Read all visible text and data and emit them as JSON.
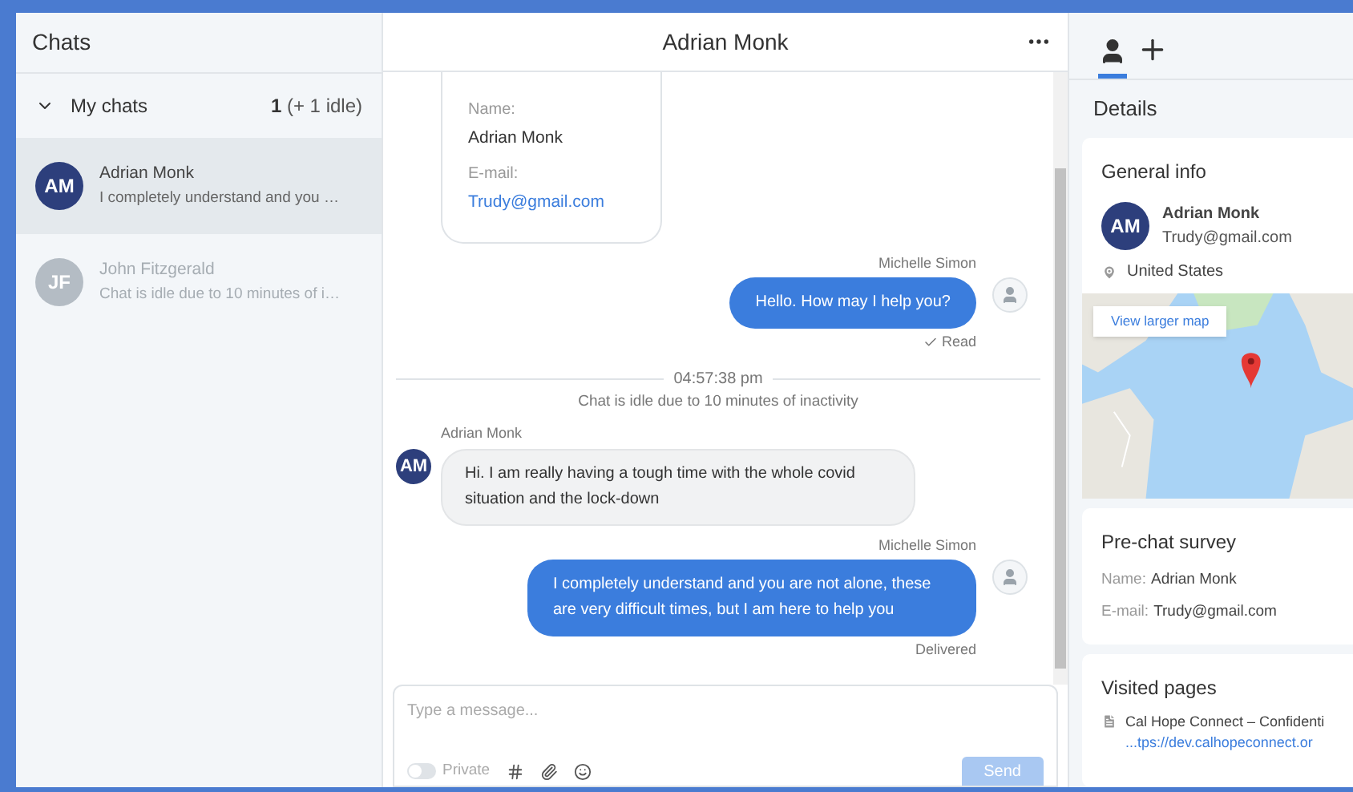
{
  "sidebar": {
    "title": "Chats",
    "group": {
      "label": "My chats",
      "expanded": true,
      "count": "1",
      "idle": "(+ 1 idle)"
    },
    "chats": [
      {
        "initials": "AM",
        "name": "Adrian Monk",
        "preview": "I completely understand and you …",
        "selected": true,
        "idle": false
      },
      {
        "initials": "JF",
        "name": "John Fitzgerald",
        "preview": "Chat is idle due to 10 minutes of i…",
        "selected": false,
        "idle": true
      }
    ]
  },
  "conversation": {
    "title": "Adrian Monk",
    "form_card": [
      {
        "label": "Name:",
        "value": "Adrian Monk",
        "kind": "text"
      },
      {
        "label": "E-mail:",
        "value": "Trudy@gmail.com",
        "kind": "link"
      }
    ],
    "messages": [
      {
        "kind": "agent",
        "author": "Michelle Simon",
        "text": "Hello. How may I help you?",
        "status": "Read",
        "read": true
      },
      {
        "kind": "system",
        "time": "04:57:38 pm",
        "text": "Chat is idle due to 10 minutes of inactivity"
      },
      {
        "kind": "visitor",
        "author": "Adrian Monk",
        "initials": "AM",
        "text": "Hi. I am really having a tough time with the whole covid situation and the lock-down"
      },
      {
        "kind": "agent",
        "author": "Michelle Simon",
        "text": "I completely understand and you are not alone, these are very difficult times, but I am here to help you",
        "status": "Delivered",
        "read": false
      }
    ],
    "composer": {
      "placeholder": "Type a message...",
      "private_label": "Private",
      "private_on": false,
      "send": "Send",
      "send_disabled": true
    }
  },
  "details": {
    "tabs": [
      {
        "kind": "person",
        "selected": true
      },
      {
        "kind": "add",
        "selected": false
      }
    ],
    "title": "Details",
    "general_info": {
      "title": "General info",
      "initials": "AM",
      "name": "Adrian Monk",
      "email": "Trudy@gmail.com",
      "location": "United States",
      "map_button": "View larger map"
    },
    "pre_chat_survey": {
      "title": "Pre-chat survey",
      "fields": [
        {
          "label": "Name:",
          "value": "Adrian Monk"
        },
        {
          "label": "E-mail:",
          "value": "Trudy@gmail.com"
        }
      ]
    },
    "visited_pages": {
      "title": "Visited pages",
      "pages": [
        {
          "title": "Cal Hope Connect – Confidenti",
          "url": "...tps://dev.calhopeconnect.or"
        }
      ]
    }
  }
}
